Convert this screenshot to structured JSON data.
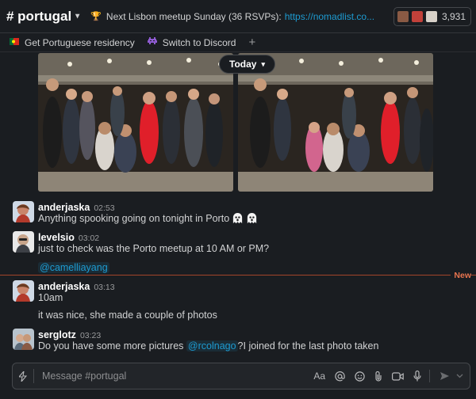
{
  "header": {
    "channel": "# portugal",
    "topic_text": "Next Lisbon meetup Sunday (36 RSVPs):",
    "topic_link": "https://nomadlist.co...",
    "member_count": "3,931"
  },
  "bookmarks": [
    {
      "label": "Get Portuguese residency",
      "icon": "portugal-flag-icon"
    },
    {
      "label": "Switch to Discord",
      "icon": "space-invader-icon"
    }
  ],
  "date_pill": "Today",
  "messages": [
    {
      "author": "anderjaska",
      "time": "02:53",
      "lines": [
        "Anything spooking going on tonight in Porto"
      ]
    },
    {
      "author": "levelsio",
      "time": "03:02",
      "lines": [
        "just to check was the Porto meetup at 10 AM or PM?"
      ],
      "mention": "@camelliayang"
    },
    {
      "author": "anderjaska",
      "time": "03:13",
      "lines": [
        "10am",
        "it was nice, she made a couple of photos"
      ]
    },
    {
      "author": "serglotz",
      "time": "03:23",
      "text_before": "Do you have some more pictures",
      "mention": "@rcolnago",
      "text_after": "?I joined for the last photo taken"
    }
  ],
  "new_label": "New",
  "composer": {
    "placeholder": "Message #portugal",
    "format_label": "Aa"
  },
  "colors": {
    "background": "#1a1d21",
    "link": "#1d9bd1",
    "new_divider": "#e8744f"
  }
}
